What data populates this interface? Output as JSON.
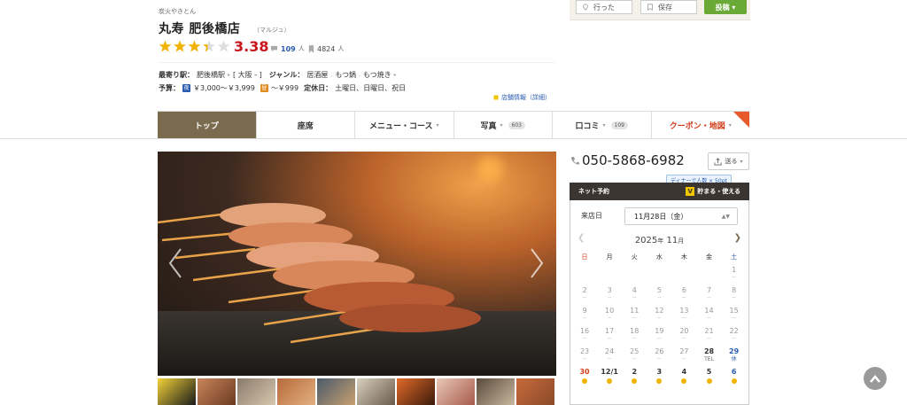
{
  "top_actions": {
    "went_label": "行った",
    "save_label": "保存",
    "reserve_label": "投稿"
  },
  "header": {
    "kicker": "炭火やきとん",
    "name": "丸寿 肥後橋店",
    "kana": "（マルジュ）",
    "rating": "3.38",
    "rating_fraction": 0.676,
    "review_count": "109",
    "review_unit": "人",
    "save_count": "4824",
    "save_unit": "人"
  },
  "info": {
    "station_label": "最寄り駅：",
    "station": "肥後橋駅",
    "area": "[ 大阪 - ]",
    "genre_label": "ジャンル：",
    "genres": [
      "居酒屋",
      "もつ鍋",
      "もつ焼き"
    ],
    "budget_label": "予算：",
    "dinner_icon": "夜",
    "dinner_budget": "￥3,000～￥3,999",
    "lunch_icon": "昼",
    "lunch_budget": "～￥999",
    "holiday_label": "定休日：",
    "holiday": "土曜日、日曜日、祝日",
    "shop_info_link": "店舗情報（詳細）"
  },
  "tabs": [
    {
      "label": "トップ",
      "active": true
    },
    {
      "label": "座席"
    },
    {
      "label": "メニュー・コース"
    },
    {
      "label": "写真",
      "count": "603"
    },
    {
      "label": "口コミ",
      "count": "109"
    },
    {
      "label": "クーポン・地図"
    }
  ],
  "sidebar": {
    "phone": "050-5868-6982",
    "send_label": "送る",
    "promo": "ディナーで人数 × 50pt",
    "net_reserve": "ネット予約",
    "points_label": "貯まる・使える",
    "visit_label": "来店日",
    "selected_date": "11月28日（金）",
    "calendar": {
      "year": "2025",
      "year_suffix": "年",
      "month": "11",
      "month_suffix": "月",
      "weekdays": [
        "日",
        "月",
        "火",
        "水",
        "木",
        "金",
        "土"
      ],
      "weeks": [
        [
          {
            "d": ""
          },
          {
            "d": ""
          },
          {
            "d": ""
          },
          {
            "d": ""
          },
          {
            "d": ""
          },
          {
            "d": ""
          },
          {
            "d": "1",
            "m": "－"
          }
        ],
        [
          {
            "d": "2",
            "m": "－"
          },
          {
            "d": "3",
            "m": "－"
          },
          {
            "d": "4",
            "m": "－"
          },
          {
            "d": "5",
            "m": "－"
          },
          {
            "d": "6",
            "m": "－"
          },
          {
            "d": "7",
            "m": "－"
          },
          {
            "d": "8",
            "m": "－"
          }
        ],
        [
          {
            "d": "9",
            "m": "－"
          },
          {
            "d": "10",
            "m": "－"
          },
          {
            "d": "11",
            "m": "－"
          },
          {
            "d": "12",
            "m": "－"
          },
          {
            "d": "13",
            "m": "－"
          },
          {
            "d": "14",
            "m": "－"
          },
          {
            "d": "15",
            "m": "－"
          }
        ],
        [
          {
            "d": "16",
            "m": "－"
          },
          {
            "d": "17",
            "m": "－"
          },
          {
            "d": "18",
            "m": "－"
          },
          {
            "d": "19",
            "m": "－"
          },
          {
            "d": "20",
            "m": "－"
          },
          {
            "d": "21",
            "m": "－"
          },
          {
            "d": "22",
            "m": "－"
          }
        ],
        [
          {
            "d": "23",
            "m": "－"
          },
          {
            "d": "24",
            "m": "－"
          },
          {
            "d": "25",
            "m": "－"
          },
          {
            "d": "26",
            "m": "－"
          },
          {
            "d": "27",
            "m": "－"
          },
          {
            "d": "28",
            "m": "TEL",
            "on": true
          },
          {
            "d": "29",
            "m": "休",
            "on": true,
            "hol": true
          }
        ],
        [
          {
            "d": "30",
            "on": true,
            "dot": true
          },
          {
            "d": "12/1",
            "on": true,
            "dot": true
          },
          {
            "d": "2",
            "on": true,
            "dot": true
          },
          {
            "d": "3",
            "on": true,
            "dot": true
          },
          {
            "d": "4",
            "on": true,
            "dot": true
          },
          {
            "d": "5",
            "on": true,
            "dot": true
          },
          {
            "d": "6",
            "on": true,
            "dot": true
          }
        ]
      ]
    }
  },
  "colors": {
    "accent": "#7a6b4f",
    "rating_red": "#c8161d",
    "link_blue": "#2a5db0",
    "coupon": "#e65a2c"
  }
}
